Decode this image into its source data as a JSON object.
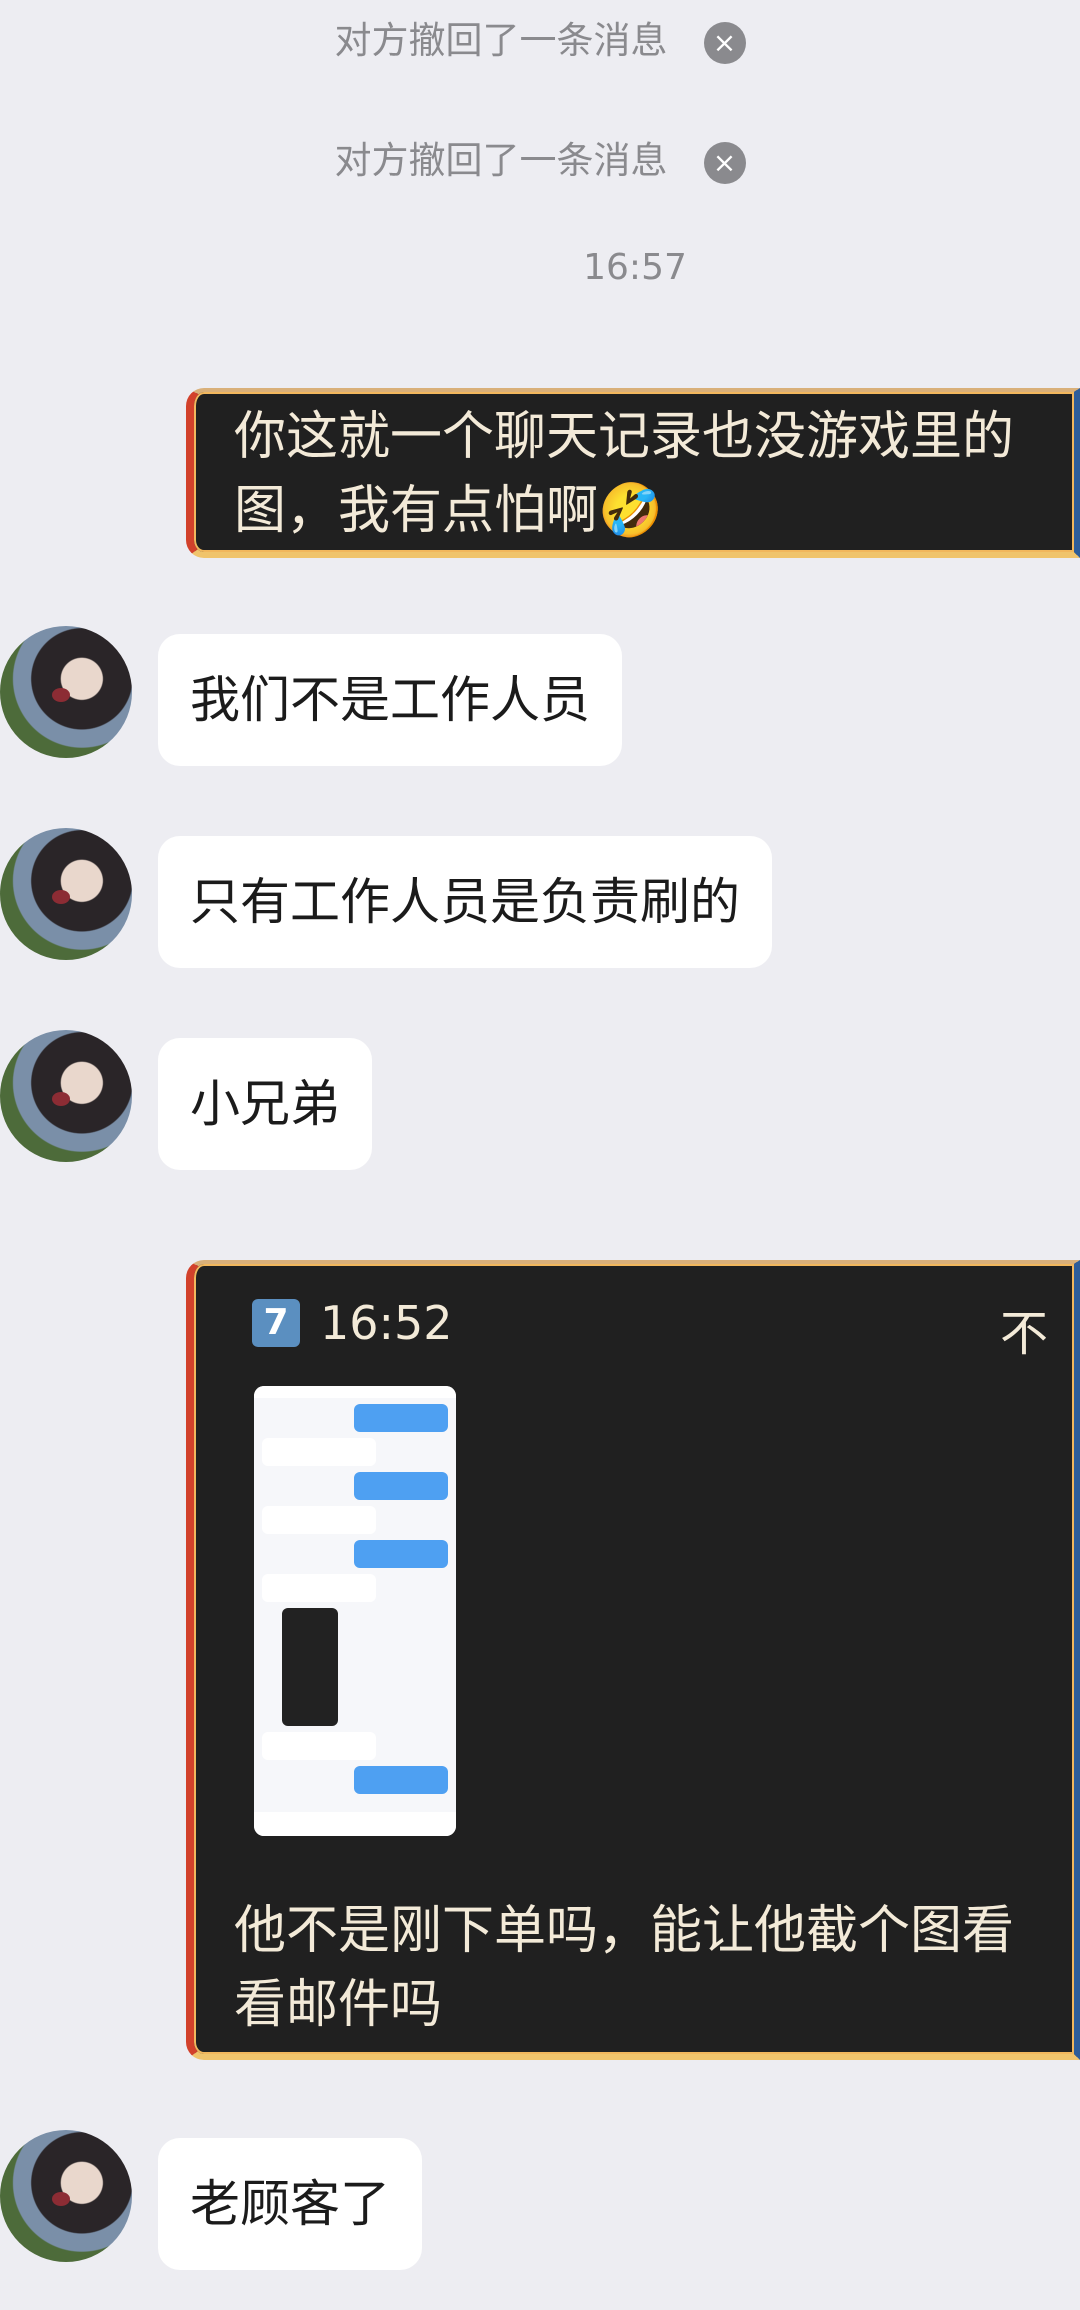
{
  "notices": [
    {
      "text": "对方撤回了一条消息"
    },
    {
      "text": "对方撤回了一条消息"
    }
  ],
  "timestamp": "16:57",
  "messages": {
    "out1": "你这就一个聊天记录也没游戏里的图，我有点怕啊🤣",
    "in1": "我们不是工作人员",
    "in2": "只有工作人员是负责刷的",
    "in3": "小兄弟",
    "out2": {
      "record_count": "7",
      "record_time": "16:52",
      "pin_icon": "不",
      "text": "他不是刚下单吗，能让他截个图看看邮件吗"
    },
    "in4": "老顾客了"
  },
  "icons": {
    "close": "×"
  }
}
